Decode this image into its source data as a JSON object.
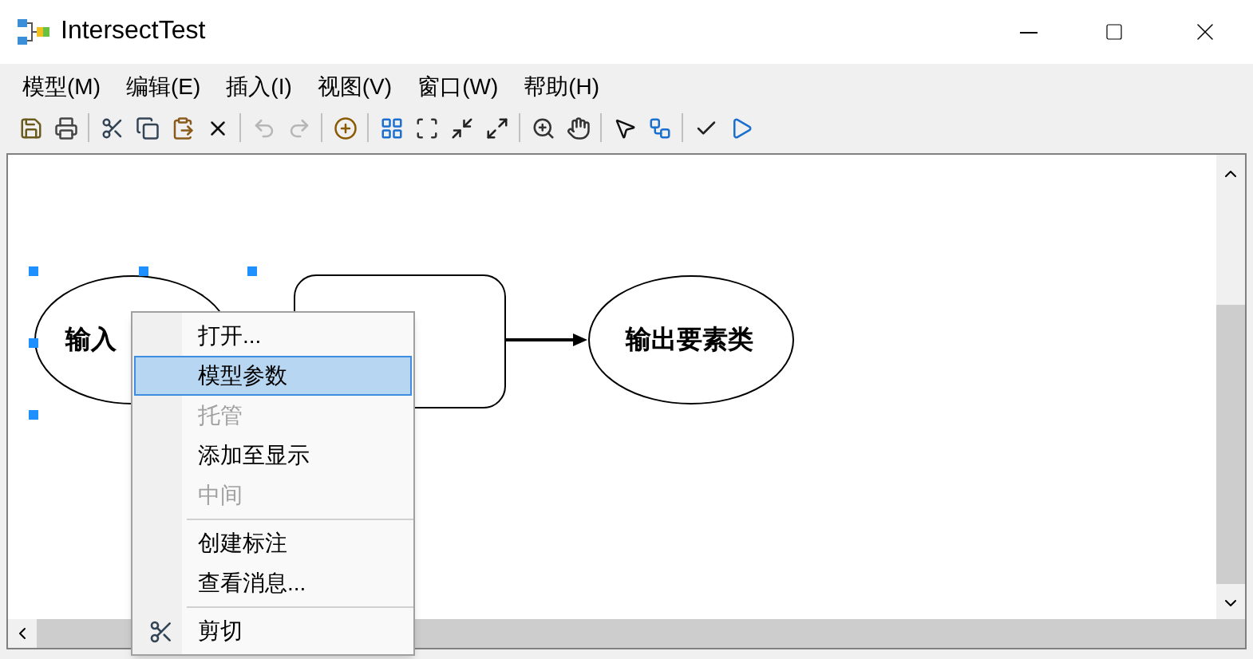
{
  "window": {
    "title": "IntersectTest"
  },
  "menu_bar": [
    "模型(M)",
    "编辑(E)",
    "插入(I)",
    "视图(V)",
    "窗口(W)",
    "帮助(H)"
  ],
  "toolbar": [
    [
      {
        "kind": "save",
        "disabled": false
      },
      {
        "kind": "print",
        "disabled": false
      }
    ],
    [
      {
        "kind": "cut",
        "disabled": false
      },
      {
        "kind": "copy",
        "disabled": false
      },
      {
        "kind": "paste",
        "disabled": false
      },
      {
        "kind": "delete",
        "disabled": false
      }
    ],
    [
      {
        "kind": "undo",
        "disabled": true
      },
      {
        "kind": "redo",
        "disabled": true
      }
    ],
    [
      {
        "kind": "add",
        "disabled": false
      }
    ],
    [
      {
        "kind": "layout",
        "disabled": false
      },
      {
        "kind": "full",
        "disabled": false
      },
      {
        "kind": "shrink",
        "disabled": false
      },
      {
        "kind": "expand",
        "disabled": false
      }
    ],
    [
      {
        "kind": "zoom",
        "disabled": false
      },
      {
        "kind": "pan",
        "disabled": false
      }
    ],
    [
      {
        "kind": "select",
        "disabled": false
      },
      {
        "kind": "connect",
        "disabled": false
      }
    ],
    [
      {
        "kind": "validate",
        "disabled": false
      },
      {
        "kind": "run",
        "disabled": false
      }
    ]
  ],
  "diagram": {
    "nodes": [
      {
        "kind": "ellipse",
        "label": "输入",
        "selected": true
      },
      {
        "kind": "process",
        "selected": false
      },
      {
        "kind": "ellipse",
        "label": "输出要素类",
        "selected": false
      }
    ]
  },
  "context_menu": {
    "items": [
      {
        "kind": "item",
        "label": "打开...",
        "selected": false,
        "disabled": false,
        "icon": false
      },
      {
        "kind": "item",
        "label": "模型参数",
        "selected": true,
        "disabled": false,
        "icon": false
      },
      {
        "kind": "item",
        "label": "托管",
        "selected": false,
        "disabled": true,
        "icon": false
      },
      {
        "kind": "item",
        "label": "添加至显示",
        "selected": false,
        "disabled": false,
        "icon": false
      },
      {
        "kind": "item",
        "label": "中间",
        "selected": false,
        "disabled": true,
        "icon": false
      },
      {
        "kind": "separator"
      },
      {
        "kind": "item",
        "label": "创建标注",
        "selected": false,
        "disabled": false,
        "icon": false
      },
      {
        "kind": "item",
        "label": "查看消息...",
        "selected": false,
        "disabled": false,
        "icon": false
      },
      {
        "kind": "separator"
      },
      {
        "kind": "item",
        "label": "剪切",
        "selected": false,
        "disabled": false,
        "icon": true
      }
    ]
  }
}
